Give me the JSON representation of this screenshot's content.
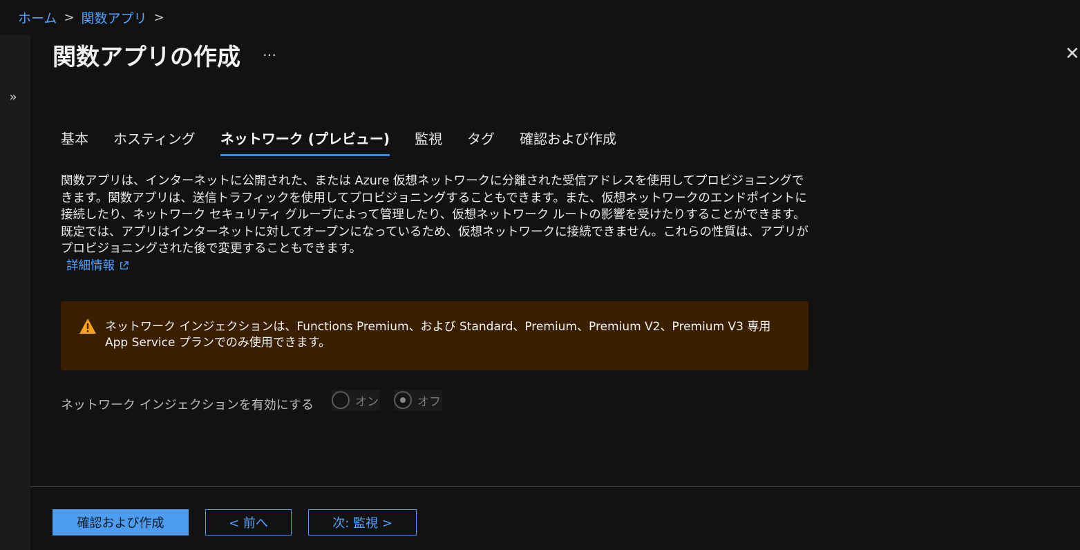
{
  "breadcrumb": {
    "items": [
      "ホーム",
      "関数アプリ"
    ],
    "separator": ">"
  },
  "page": {
    "title": "関数アプリの作成",
    "more": "…",
    "close": "✕"
  },
  "tabs": [
    {
      "label": "基本",
      "active": false
    },
    {
      "label": "ホスティング",
      "active": false
    },
    {
      "label": "ネットワーク (プレビュー)",
      "active": true
    },
    {
      "label": "監視",
      "active": false
    },
    {
      "label": "タグ",
      "active": false
    },
    {
      "label": "確認および作成",
      "active": false
    }
  ],
  "description": {
    "text": "関数アプリは、インターネットに公開された、または Azure 仮想ネットワークに分離された受信アドレスを使用してプロビジョニングできます。関数アプリは、送信トラフィックを使用してプロビジョニングすることもできます。また、仮想ネットワークのエンドポイントに接続したり、ネットワーク セキュリティ グループによって管理したり、仮想ネットワーク ルートの影響を受けたりすることができます。既定では、アプリはインターネットに対してオープンになっているため、仮想ネットワークに接続できません。これらの性質は、アプリがプロビジョニングされた後で変更することもできます。",
    "learn_more": "詳細情報"
  },
  "warning": {
    "text": "ネットワーク インジェクションは、Functions Premium、および Standard、Premium、Premium V2、Premium V3 専用 App Service プランでのみ使用できます。"
  },
  "setting": {
    "label": "ネットワーク インジェクションを有効にする",
    "options": [
      {
        "label": "オン",
        "checked": false
      },
      {
        "label": "オフ",
        "checked": true
      }
    ],
    "disabled": true
  },
  "footer": {
    "review_create": "確認および作成",
    "previous": "< 前へ",
    "next": "次: 監視 >"
  },
  "colors": {
    "accent": "#4d9cf0",
    "warning_bg": "#3a1f00",
    "warning_icon": "#f7a21b"
  }
}
